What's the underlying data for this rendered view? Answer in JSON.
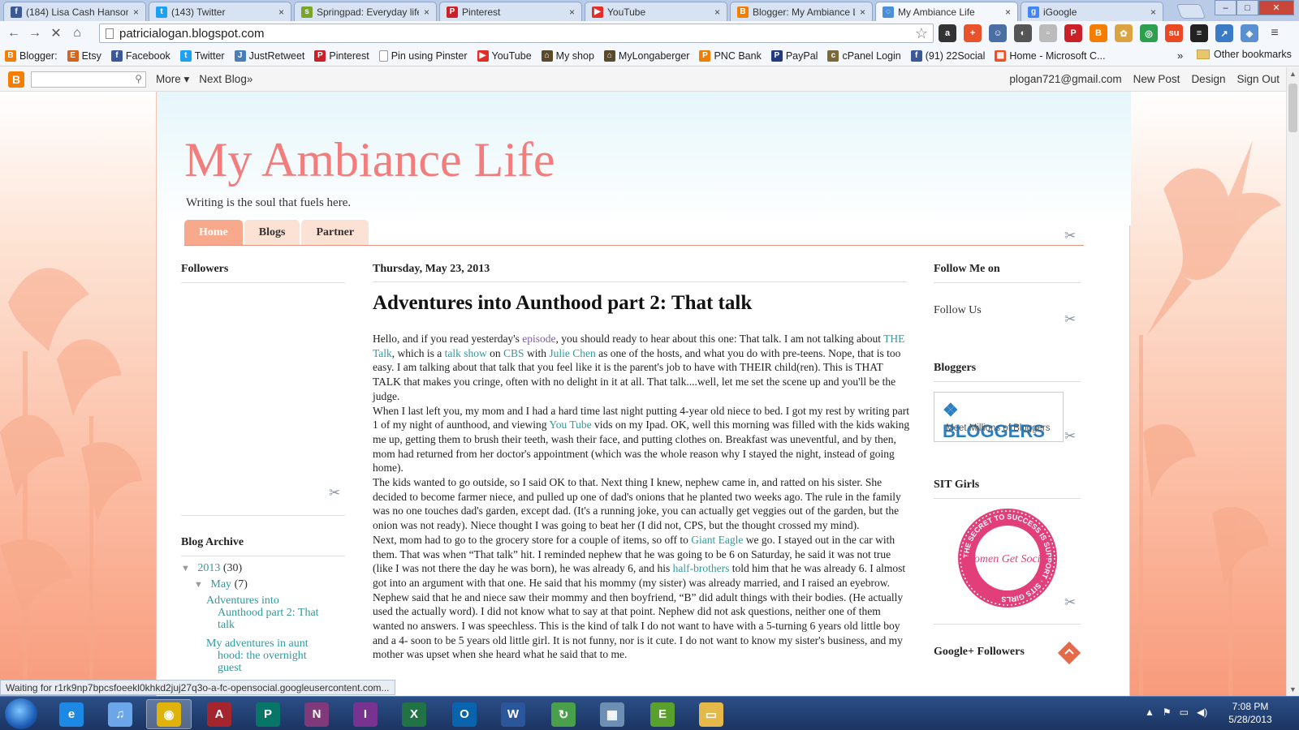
{
  "browser": {
    "tabs": [
      {
        "label": "(184) Lisa Cash Hanson",
        "icon": "facebook-icon",
        "color": "#3b5998",
        "glyph": "f"
      },
      {
        "label": "(143) Twitter",
        "icon": "twitter-icon",
        "color": "#1da1f2",
        "glyph": "t"
      },
      {
        "label": "Springpad: Everyday life",
        "icon": "springpad-icon",
        "color": "#7aa52b",
        "glyph": "s"
      },
      {
        "label": "Pinterest",
        "icon": "pinterest-icon",
        "color": "#cb2027",
        "glyph": "P"
      },
      {
        "label": "YouTube",
        "icon": "youtube-icon",
        "color": "#e52d27",
        "glyph": "▶"
      },
      {
        "label": "Blogger: My Ambiance L",
        "icon": "blogger-icon",
        "color": "#f57d00",
        "glyph": "B"
      },
      {
        "label": "My Ambiance Life",
        "icon": "loading-icon",
        "color": "#4a90d9",
        "glyph": "◌"
      },
      {
        "label": "iGoogle",
        "icon": "google-icon",
        "color": "#4285f4",
        "glyph": "g"
      }
    ],
    "close_glyph": "×",
    "window_controls": {
      "minimize": "–",
      "maximize": "□",
      "close": "✕"
    },
    "url": "patricialogan.blogspot.com",
    "bookmarks": [
      {
        "label": "Blogger:",
        "icon": "blogger-icon",
        "color": "#f57d00",
        "glyph": "B"
      },
      {
        "label": "Etsy",
        "icon": "etsy-icon",
        "color": "#d5641c",
        "glyph": "E"
      },
      {
        "label": "Facebook",
        "icon": "facebook-icon",
        "color": "#3b5998",
        "glyph": "f"
      },
      {
        "label": "Twitter",
        "icon": "twitter-icon",
        "color": "#1da1f2",
        "glyph": "t"
      },
      {
        "label": "JustRetweet",
        "icon": "justretweet-icon",
        "color": "#4a7ebb",
        "glyph": "J"
      },
      {
        "label": "Pinterest",
        "icon": "pinterest-icon",
        "color": "#cb2027",
        "glyph": "P"
      },
      {
        "label": "Pin using Pinster",
        "icon": "page-icon",
        "color": "#999999",
        "glyph": ""
      },
      {
        "label": "YouTube",
        "icon": "youtube-icon",
        "color": "#e52d27",
        "glyph": "▶"
      },
      {
        "label": "My shop",
        "icon": "basket-icon",
        "color": "#5a4a2a",
        "glyph": "⌂"
      },
      {
        "label": "MyLongaberger",
        "icon": "basket-icon",
        "color": "#5a4a2a",
        "glyph": "⌂"
      },
      {
        "label": "PNC Bank",
        "icon": "pnc-icon",
        "color": "#ef7d00",
        "glyph": "P"
      },
      {
        "label": "PayPal",
        "icon": "paypal-icon",
        "color": "#253b80",
        "glyph": "P"
      },
      {
        "label": "cPanel Login",
        "icon": "cpanel-icon",
        "color": "#7a6a3a",
        "glyph": "c"
      },
      {
        "label": "(91) 22Social",
        "icon": "facebook-icon",
        "color": "#3b5998",
        "glyph": "f"
      },
      {
        "label": "Home - Microsoft C...",
        "icon": "microsoft-icon",
        "color": "#f25022",
        "glyph": "▦"
      }
    ],
    "bookmarks_more": "»",
    "other_bookmarks": "Other bookmarks",
    "status_text": "Waiting for r1rk9np7bpcsfoeekl0khkd2juj27q3o-a-fc-opensocial.googleusercontent.com..."
  },
  "blogger_nav": {
    "more": "More ▾",
    "next_blog": "Next Blog»",
    "email": "plogan721@gmail.com",
    "new_post": "New Post",
    "design": "Design",
    "sign_out": "Sign Out"
  },
  "blog": {
    "title": "My Ambiance Life",
    "description": "Writing is the soul that fuels here.",
    "tabs": [
      "Home",
      "Blogs",
      "Partner"
    ],
    "accent": "#f27d7d"
  },
  "sidebar_left": {
    "followers_heading": "Followers",
    "archive_heading": "Blog Archive",
    "year": "2013",
    "year_count": "(30)",
    "month": "May",
    "month_count": "(7)",
    "posts": [
      "Adventures into Aunthood part 2: That talk",
      "My adventures in aunt hood: the overnight guest"
    ]
  },
  "post": {
    "date": "Thursday, May 23, 2013",
    "title": "Adventures into Aunthood part 2: That talk",
    "p1": [
      "Hello, and if you read yesterday's ",
      "episode",
      ", you should ready to hear about this one:  That talk.  I am not talking about ",
      "THE Talk",
      ", which is a ",
      "talk show",
      " on ",
      "CBS",
      " with ",
      "Julie Chen",
      " as one of the hosts, and what you do with pre-teens.  Nope, that is too easy.   I am talking about that talk that you feel like it is the parent's job to have with THEIR child(ren).  This is THAT TALK that makes you cringe, often with no delight in it at all.  That talk....well, let me set the scene up and you'll be the judge."
    ],
    "p2": [
      "When I last left you, my mom and I had a hard time last night putting 4-year old niece to bed.  I got my rest by writing part 1 of my night of aunthood, and viewing ",
      "You Tube",
      " vids on my Ipad.   OK, well this morning was filled with the kids waking me up, getting them to brush their teeth, wash their face, and putting clothes on.  Breakfast was uneventful, and by then, mom had returned from her doctor's appointment (which was the whole reason why I stayed the night, instead of going home)."
    ],
    "p3": "The kids wanted to go outside, so I said OK to that.  Next thing I knew, nephew came in, and ratted on his sister.  She decided to become farmer niece, and pulled up one of dad's onions that he planted two weeks ago.  The rule in the family was no one touches dad's garden, except dad.  (It's a running joke, you can actually get veggies out of the garden, but the onion was not ready).   Niece thought I was going to beat her (I did not, CPS, but the thought crossed my mind).",
    "p4": [
      "Next, mom had to go to the grocery store for a couple of items, so off to ",
      "Giant Eagle",
      " we go.   I stayed out in the car with them.  That was when “That talk” hit.   I reminded nephew that he was going to be 6 on Saturday, he said it was not true (like I was not there the day he was born), he was already 6, and his ",
      "half-brothers",
      " told him that he was already 6.   I almost got into an argument with that one.  He said that his mommy (my sister) was already married, and I raised an eyebrow.   Nephew said that he and niece saw their mommy and then boyfriend, “B” did adult things with their bodies. (He actually used the actually word).  I did not know what to say at that point.  Nephew did not ask questions, neither one of them wanted no answers.   I was speechless.   This is the kind of talk I do not want to have with a 5-turning 6 years old little boy and a 4- soon to be 5 years old little girl.   It is not funny, nor is it cute.   I do not want to know my sister's business, and my mother was upset when she heard what he said that to me."
    ]
  },
  "sidebar_right": {
    "follow_heading": "Follow Me on",
    "follow_text": "Follow Us",
    "bloggers_heading": "Bloggers",
    "bloggers_badge_logo": "BLOGGERS",
    "bloggers_badge_sub": "Meet Millions of Bloggers",
    "sit_heading": "SIT Girls",
    "sit_badge_ring": "THE SECRET TO SUCCESS IS SUPPORT · SITS GIRLS",
    "sit_badge_text": "Women Get Social",
    "gplus_heading": "Google+ Followers"
  },
  "taskbar": {
    "apps": [
      {
        "name": "internet-explorer",
        "color": "#1e88e5",
        "glyph": "e"
      },
      {
        "name": "itunes",
        "color": "#6aa6e8",
        "glyph": "♫"
      },
      {
        "name": "chrome",
        "color": "#e0b30b",
        "glyph": "◉"
      },
      {
        "name": "access",
        "color": "#a4262c",
        "glyph": "A"
      },
      {
        "name": "publisher",
        "color": "#077568",
        "glyph": "P"
      },
      {
        "name": "onenote",
        "color": "#80397b",
        "glyph": "N"
      },
      {
        "name": "infopath",
        "color": "#77338f",
        "glyph": "I"
      },
      {
        "name": "excel",
        "color": "#217346",
        "glyph": "X"
      },
      {
        "name": "outlook",
        "color": "#0a64ad",
        "glyph": "O"
      },
      {
        "name": "word",
        "color": "#2b579a",
        "glyph": "W"
      },
      {
        "name": "sync",
        "color": "#4aa04a",
        "glyph": "↻"
      },
      {
        "name": "calculator",
        "color": "#6d8fb3",
        "glyph": "▦"
      },
      {
        "name": "evernote",
        "color": "#5aa02c",
        "glyph": "E"
      },
      {
        "name": "explorer",
        "color": "#e5b84a",
        "glyph": "▭"
      }
    ],
    "time": "7:08 PM",
    "date": "5/28/2013"
  }
}
